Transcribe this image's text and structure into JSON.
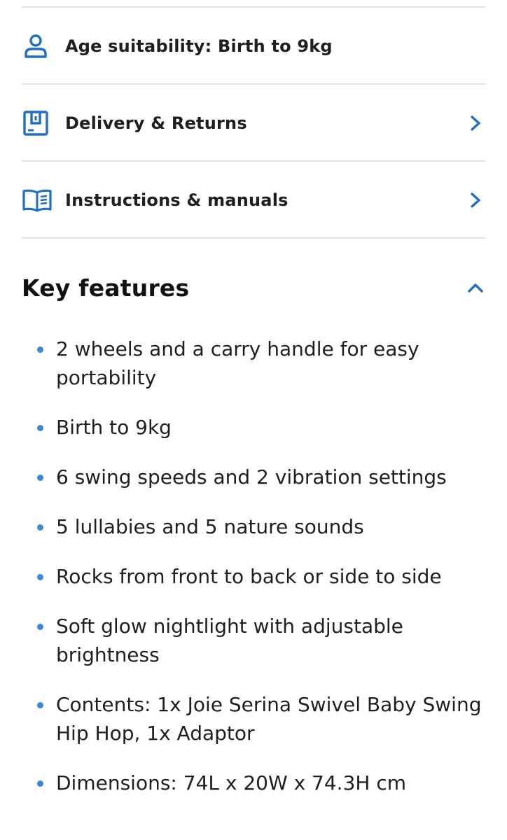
{
  "colors": {
    "accent": "#1f6fc7",
    "bullet": "#3a88d6",
    "divider": "#e2e2e2",
    "text": "#1f1f1f"
  },
  "info_rows": [
    {
      "icon": "person-icon",
      "label": "Age suitability: Birth to 9kg",
      "has_chevron": false
    },
    {
      "icon": "delivery-box-icon",
      "label": "Delivery & Returns",
      "has_chevron": true
    },
    {
      "icon": "book-icon",
      "label": "Instructions & manuals",
      "has_chevron": true
    }
  ],
  "key_features": {
    "title": "Key features",
    "expanded": true,
    "items": [
      "2 wheels and a carry handle for easy portability",
      "Birth to 9kg",
      "6 swing speeds and 2 vibration settings",
      "5 lullabies and 5 nature sounds",
      "Rocks from front to back or side to side",
      "Soft glow nightlight with adjustable brightness",
      "Contents: 1x Joie Serina Swivel Baby Swing Hip Hop, 1x Adaptor",
      "Dimensions: 74L x 20W x 74.3H cm"
    ]
  }
}
